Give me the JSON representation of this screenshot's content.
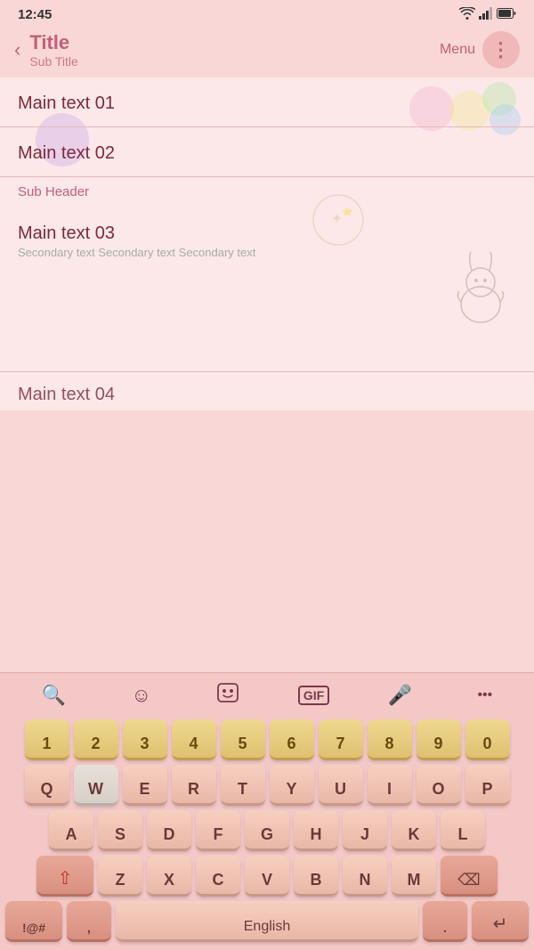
{
  "status": {
    "time": "12:45",
    "wifi": "WiFi",
    "signal": "Signal",
    "battery": "Battery"
  },
  "header": {
    "back_icon": "‹",
    "title": "Title",
    "subtitle": "Sub Title",
    "menu_label": "Menu",
    "more_icon": "⋮"
  },
  "content": {
    "items": [
      {
        "id": 1,
        "main": "Main text 01",
        "secondary": ""
      },
      {
        "id": 2,
        "main": "Main text 02",
        "secondary": ""
      },
      {
        "id": 3,
        "main": "Main text 03",
        "secondary": "Secondary text Secondary text Secondary text"
      },
      {
        "id": 4,
        "main": "Main text 04",
        "secondary": ""
      }
    ],
    "sub_header": "Sub Header"
  },
  "keyboard": {
    "toolbar": {
      "search": "🔍",
      "emoji": "☺",
      "sticker": "🎭",
      "gif": "GIF",
      "mic": "🎤",
      "more": "···"
    },
    "rows": {
      "numbers": [
        "1",
        "2",
        "3",
        "4",
        "5",
        "6",
        "7",
        "8",
        "9",
        "0"
      ],
      "row1": [
        "Q",
        "W",
        "E",
        "R",
        "T",
        "Y",
        "U",
        "I",
        "O",
        "P"
      ],
      "row2": [
        "A",
        "S",
        "D",
        "F",
        "G",
        "H",
        "J",
        "K",
        "L"
      ],
      "row3": [
        "Z",
        "X",
        "C",
        "V",
        "B",
        "N",
        "M"
      ],
      "subs": {
        "Q": "",
        "W": "",
        "E": "",
        "R": "",
        "T": "",
        "Y": "",
        "U": "",
        "I": "",
        "O": "",
        "P": "",
        "A": "",
        "S": "",
        "D": "",
        "F": "",
        "G": "",
        "H": "",
        "J": "",
        "K": "",
        "L": "",
        "Z": "",
        "X": "",
        "C": "",
        "V": "",
        "B": "",
        "N": "",
        "M": ""
      }
    },
    "bottom": {
      "symbols": "!@#",
      "comma": ",",
      "space": "English",
      "period": ".",
      "enter": "↵"
    },
    "shift_icon": "⇧",
    "backspace_icon": "⌫"
  }
}
